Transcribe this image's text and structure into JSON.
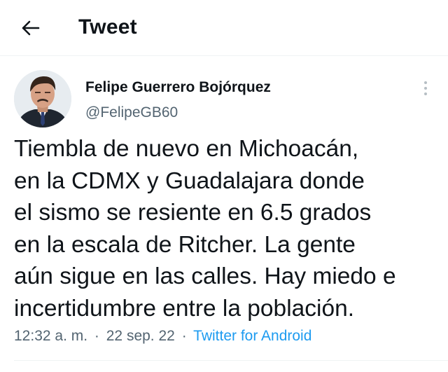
{
  "header": {
    "title": "Tweet",
    "back_icon": "arrow-left-icon"
  },
  "author": {
    "display_name": "Felipe Guerrero Bojórquez",
    "handle": "@FelipeGB60",
    "avatar_icon": "profile-photo"
  },
  "more_icon": "more-vertical-icon",
  "tweet": {
    "lines": [
      "Tiembla de nuevo en Michoacán,",
      "en la CDMX y Guadalajara donde",
      "el sismo se resiente en 6.5 grados",
      "en la escala de Ritcher. La gente",
      "aún sigue en las calles. Hay miedo e",
      "incertidumbre entre la población."
    ],
    "time": "12:32 a. m.",
    "separator": "·",
    "date": "22 sep. 22",
    "source": "Twitter for Android"
  },
  "colors": {
    "text_primary": "#0f1419",
    "text_secondary": "#536471",
    "link": "#1d9bf0",
    "divider": "#eff3f4"
  }
}
